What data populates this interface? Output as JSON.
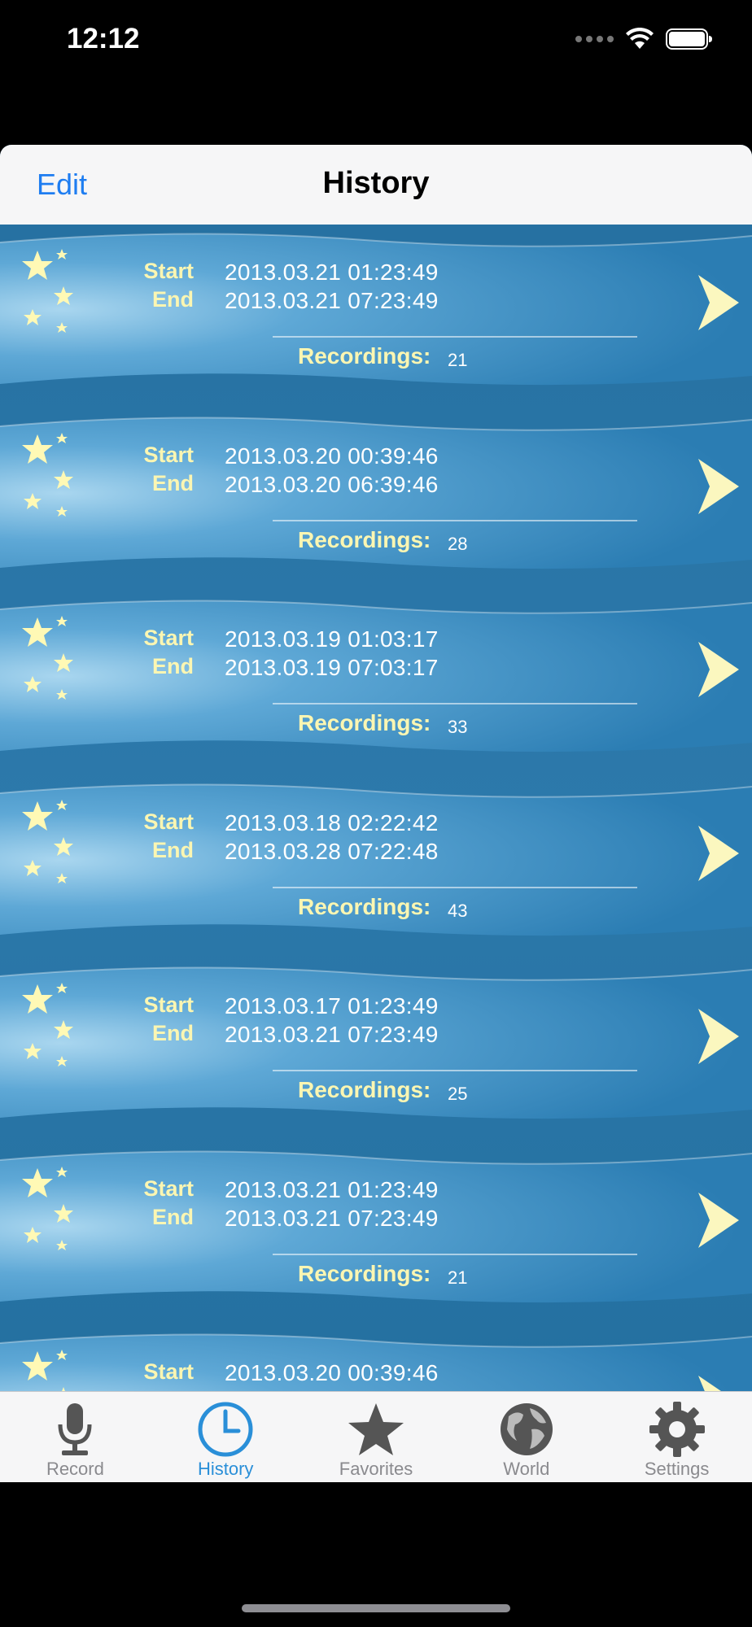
{
  "status_bar": {
    "time": "12:12"
  },
  "nav": {
    "edit_label": "Edit",
    "title": "History"
  },
  "labels": {
    "start": "Start",
    "end": "End",
    "recordings": "Recordings:"
  },
  "rows": [
    {
      "start": "2013.03.21 01:23:49",
      "end": "2013.03.21 07:23:49",
      "recordings": "21"
    },
    {
      "start": "2013.03.20 00:39:46",
      "end": "2013.03.20 06:39:46",
      "recordings": "28"
    },
    {
      "start": "2013.03.19 01:03:17",
      "end": "2013.03.19 07:03:17",
      "recordings": "33"
    },
    {
      "start": "2013.03.18 02:22:42",
      "end": "2013.03.28 07:22:48",
      "recordings": "43"
    },
    {
      "start": "2013.03.17 01:23:49",
      "end": "2013.03.21 07:23:49",
      "recordings": "25"
    },
    {
      "start": "2013.03.21 01:23:49",
      "end": "2013.03.21 07:23:49",
      "recordings": "21"
    },
    {
      "start": "2013.03.20 00:39:46"
    }
  ],
  "tabs": [
    {
      "label": "Record",
      "icon": "microphone-icon"
    },
    {
      "label": "History",
      "icon": "clock-icon",
      "active": true
    },
    {
      "label": "Favorites",
      "icon": "star-icon"
    },
    {
      "label": "World",
      "icon": "globe-icon"
    },
    {
      "label": "Settings",
      "icon": "gear-icon"
    }
  ],
  "colors": {
    "accent": "#2a8fd8",
    "list_bg": "#2671a2",
    "label_yellow": "#fbf6b2",
    "edit_blue": "#1e7df1"
  }
}
